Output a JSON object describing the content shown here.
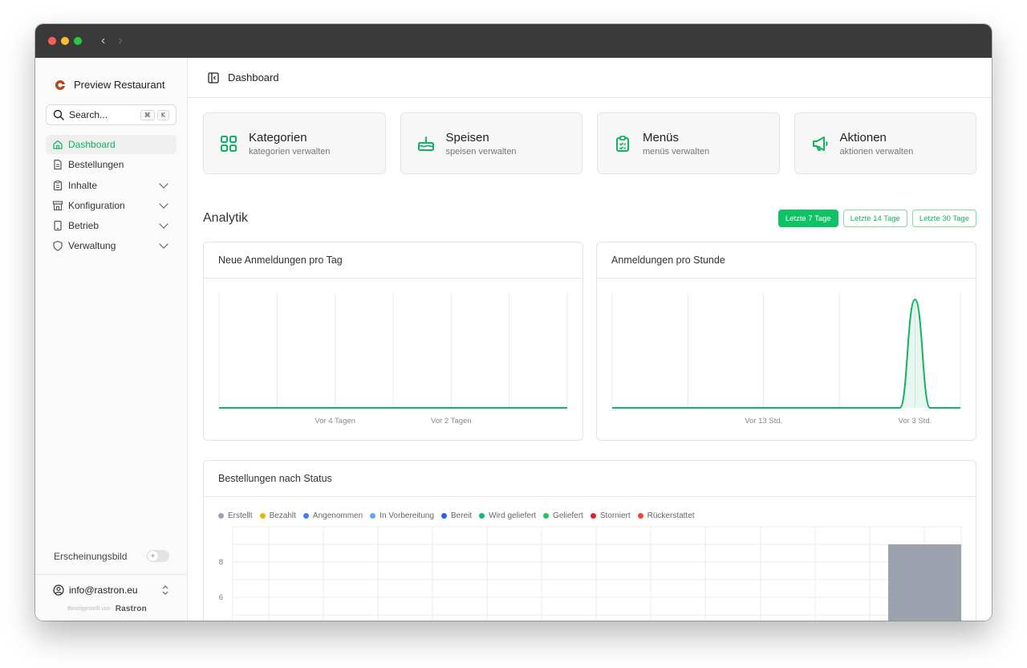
{
  "brand": {
    "name": "Preview Restaurant",
    "accent": "#10b460"
  },
  "search": {
    "label": "Search...",
    "keys": [
      "⌘",
      "K"
    ]
  },
  "menu": [
    {
      "label": "Dashboard",
      "icon": "home-icon",
      "active": true,
      "expandable": false
    },
    {
      "label": "Bestellungen",
      "icon": "document-icon",
      "active": false,
      "expandable": false
    },
    {
      "label": "Inhalte",
      "icon": "clipboard-icon",
      "active": false,
      "expandable": true
    },
    {
      "label": "Konfiguration",
      "icon": "store-icon",
      "active": false,
      "expandable": true
    },
    {
      "label": "Betrieb",
      "icon": "tablet-icon",
      "active": false,
      "expandable": true
    },
    {
      "label": "Verwaltung",
      "icon": "shield-icon",
      "active": false,
      "expandable": true
    }
  ],
  "appearance": {
    "label": "Erscheinungsbild"
  },
  "user": {
    "email": "info@rastron.eu"
  },
  "footer": {
    "powered_by": "Bereitgestellt von",
    "logo": "Rastron"
  },
  "header": {
    "title": "Dashboard"
  },
  "cards": [
    {
      "title": "Kategorien",
      "subtitle": "kategorien verwalten",
      "icon": "grid-icon"
    },
    {
      "title": "Speisen",
      "subtitle": "speisen verwalten",
      "icon": "cake-icon"
    },
    {
      "title": "Menüs",
      "subtitle": "menüs verwalten",
      "icon": "clipboard-check-icon"
    },
    {
      "title": "Aktionen",
      "subtitle": "aktionen verwalten",
      "icon": "megaphone-icon"
    }
  ],
  "analytics": {
    "title": "Analytik",
    "ranges": [
      {
        "label": "Letzte 7 Tage",
        "active": true
      },
      {
        "label": "Letzte 14 Tage",
        "active": false
      },
      {
        "label": "Letzte 30 Tage",
        "active": false
      }
    ]
  },
  "chart_data": [
    {
      "type": "area",
      "title": "Neue Anmeldungen pro Tag",
      "x_ticks": [
        "Vor 4 Tagen",
        "Vor 2 Tagen"
      ],
      "x": [
        6,
        5,
        4,
        3,
        2,
        1,
        0
      ],
      "values": [
        0,
        0,
        0,
        0,
        0,
        0,
        0
      ],
      "ylim": [
        0,
        1
      ],
      "grid": "vertical",
      "color": "#10b460"
    },
    {
      "type": "area",
      "title": "Anmeldungen pro Stunde",
      "x_ticks": [
        "Vor 13 Std.",
        "Vor 3 Std."
      ],
      "x": [
        23,
        18,
        13,
        8,
        4,
        3,
        2,
        1,
        0
      ],
      "values": [
        0,
        0,
        0,
        0,
        0,
        1,
        0,
        0,
        0
      ],
      "ylim": [
        0,
        1
      ],
      "grid": "vertical",
      "color": "#10b460"
    },
    {
      "type": "bar",
      "title": "Bestellungen nach Status",
      "legend_position": "top-left",
      "series": [
        {
          "name": "Erstellt",
          "color": "#9ca3af"
        },
        {
          "name": "Bezahlt",
          "color": "#eab308"
        },
        {
          "name": "Angenommen",
          "color": "#3b82f6"
        },
        {
          "name": "In Vorbereitung",
          "color": "#60a5fa"
        },
        {
          "name": "Bereit",
          "color": "#2563eb"
        },
        {
          "name": "Wird geliefert",
          "color": "#10b981"
        },
        {
          "name": "Geliefert",
          "color": "#22c55e"
        },
        {
          "name": "Storniert",
          "color": "#dc2626"
        },
        {
          "name": "Rückerstattet",
          "color": "#ef4444"
        }
      ],
      "y_ticks": [
        "8",
        "6"
      ],
      "bars": [
        {
          "series": "Erstellt",
          "value": 9
        }
      ],
      "ylim": [
        0,
        10
      ]
    }
  ]
}
